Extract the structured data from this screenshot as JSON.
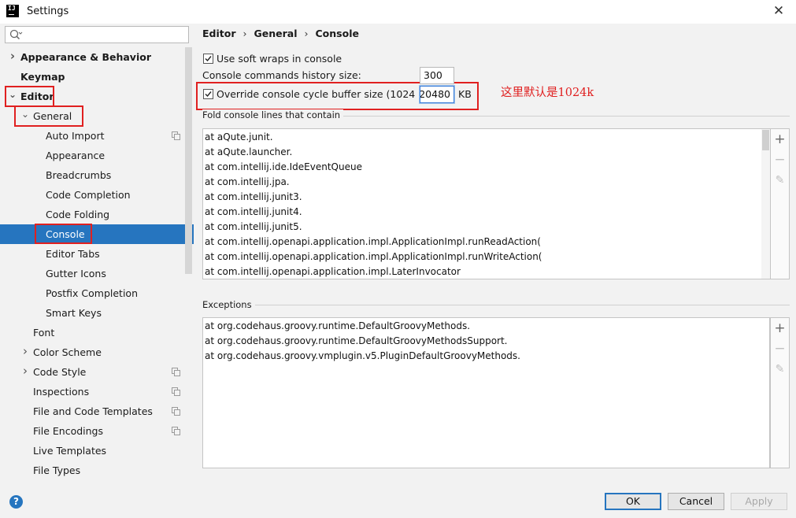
{
  "window": {
    "title": "Settings",
    "close_glyph": "✕"
  },
  "search": {
    "placeholder": ""
  },
  "tree": [
    {
      "label": "Appearance & Behavior",
      "arrow": "›",
      "bold": true
    },
    {
      "label": "Keymap",
      "bold": true
    },
    {
      "label": "Editor",
      "arrow": "⌄",
      "bold": true
    },
    {
      "label": "General",
      "arrow": "⌄"
    },
    {
      "label": "Auto Import"
    },
    {
      "label": "Appearance"
    },
    {
      "label": "Breadcrumbs"
    },
    {
      "label": "Code Completion"
    },
    {
      "label": "Code Folding"
    },
    {
      "label": "Console",
      "selected": true
    },
    {
      "label": "Editor Tabs"
    },
    {
      "label": "Gutter Icons"
    },
    {
      "label": "Postfix Completion"
    },
    {
      "label": "Smart Keys"
    },
    {
      "label": "Font"
    },
    {
      "label": "Color Scheme",
      "arrow": "›"
    },
    {
      "label": "Code Style",
      "arrow": "›"
    },
    {
      "label": "Inspections"
    },
    {
      "label": "File and Code Templates"
    },
    {
      "label": "File Encodings"
    },
    {
      "label": "Live Templates"
    },
    {
      "label": "File Types"
    }
  ],
  "breadcrumb": {
    "part1": "Editor",
    "sep": "›",
    "part2": "General",
    "part3": "Console"
  },
  "settings": {
    "soft_wraps_label": "Use soft wraps in console",
    "soft_wraps_checked": true,
    "history_label": "Console commands history size:",
    "history_value": "300",
    "override_label": "Override console cycle buffer size (1024 KB)",
    "override_checked": true,
    "buffer_value": "20480",
    "buffer_unit": "KB"
  },
  "annotation": "这里默认是1024k",
  "fold_section": {
    "title": "Fold console lines that contain",
    "rows": [
      "at aQute.junit.",
      "at aQute.launcher.",
      "at com.intellij.ide.IdeEventQueue",
      "at com.intellij.jpa.",
      "at com.intellij.junit3.",
      "at com.intellij.junit4.",
      "at com.intellij.junit5.",
      "at com.intellij.openapi.application.impl.ApplicationImpl.runReadAction(",
      "at com.intellij.openapi.application.impl.ApplicationImpl.runWriteAction(",
      "at com.intellij.openapi.application.impl.LaterInvocator"
    ]
  },
  "exceptions_section": {
    "title": "Exceptions",
    "rows": [
      "at org.codehaus.groovy.runtime.DefaultGroovyMethods.",
      "at org.codehaus.groovy.runtime.DefaultGroovyMethodsSupport.",
      "at org.codehaus.groovy.vmplugin.v5.PluginDefaultGroovyMethods."
    ]
  },
  "toolbar_glyphs": {
    "add": "+",
    "remove": "−",
    "edit": "✎"
  },
  "buttons": {
    "help": "?",
    "ok": "OK",
    "cancel": "Cancel",
    "apply": "Apply"
  },
  "colors": {
    "selection": "#2675bf",
    "annotation": "#e02020"
  }
}
